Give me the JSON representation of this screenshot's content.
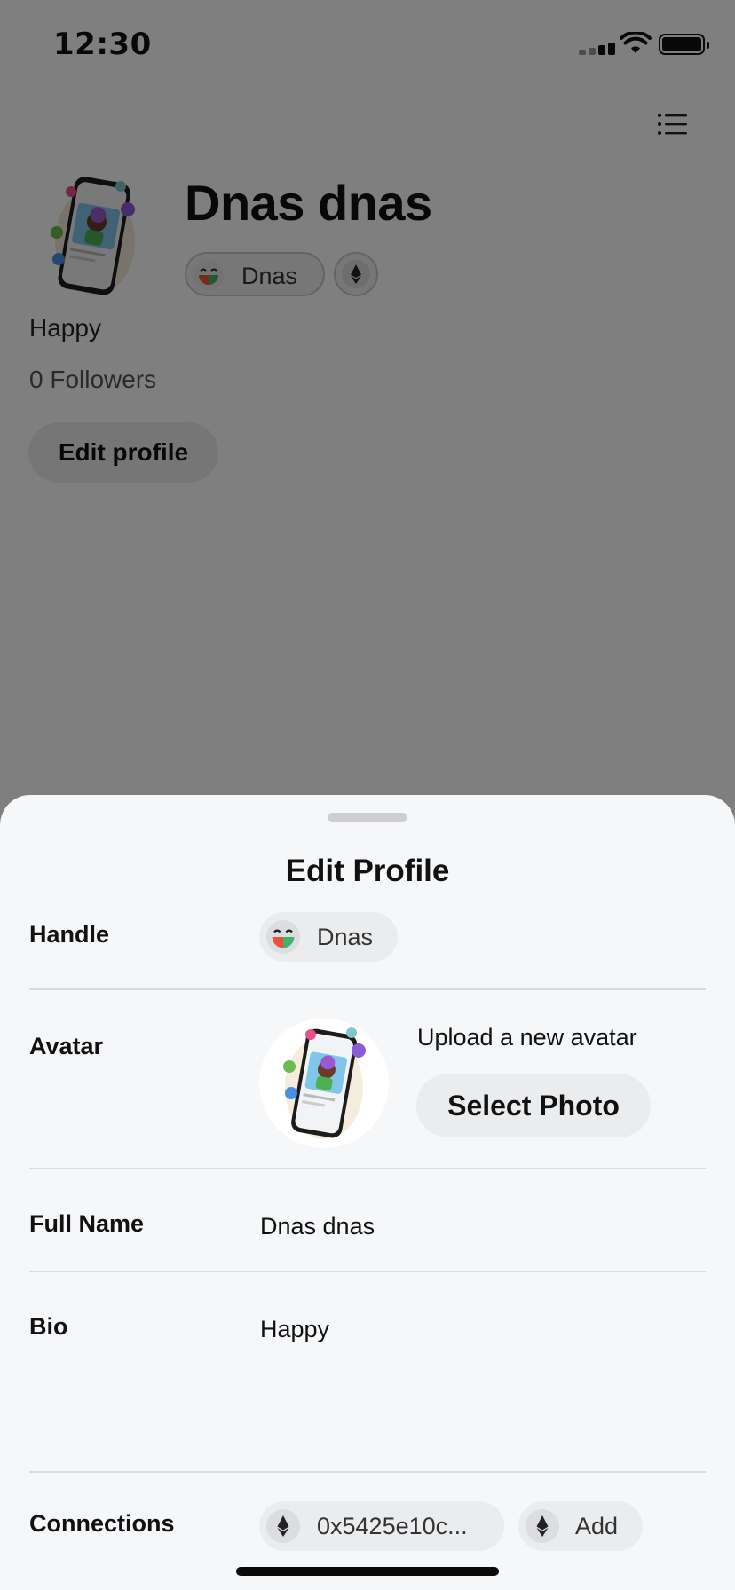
{
  "status_bar": {
    "time": "12:30"
  },
  "profile": {
    "name": "Dnas dnas",
    "handle": "Dnas",
    "bio": "Happy",
    "followers": "0 Followers",
    "edit_profile_label": "Edit profile"
  },
  "sheet": {
    "title": "Edit Profile",
    "handle": {
      "label": "Handle",
      "value": "Dnas"
    },
    "avatar": {
      "label": "Avatar",
      "upload_text": "Upload a new avatar",
      "select_photo_label": "Select Photo"
    },
    "full_name": {
      "label": "Full Name",
      "value": "Dnas dnas"
    },
    "bio": {
      "label": "Bio",
      "value": "Happy"
    },
    "connections": {
      "label": "Connections",
      "wallet": "0x5425e10c...",
      "add_label": "Add"
    }
  },
  "icons": {
    "menu": "list-menu-icon",
    "ethereum": "ethereum-icon",
    "handle_logo": "smiley-logo-icon"
  }
}
